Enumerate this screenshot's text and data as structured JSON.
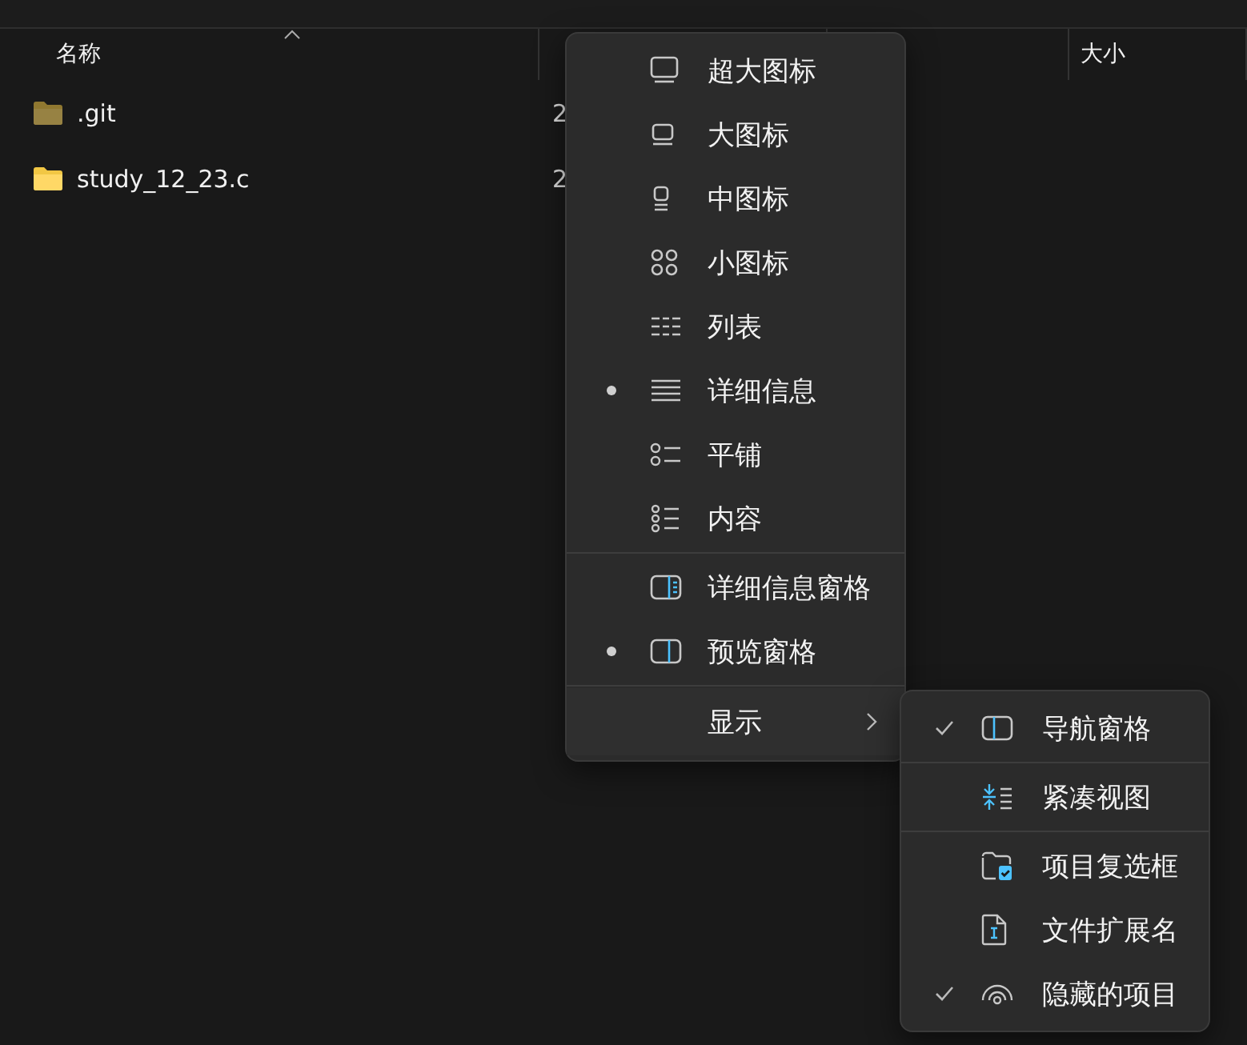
{
  "columns": [
    {
      "label": "名称",
      "sort_ascending": true
    },
    {
      "label": "大小"
    }
  ],
  "files": [
    {
      "name": ".git",
      "date": "2",
      "hidden": true
    },
    {
      "name": "study_12_23.c",
      "date": "2",
      "hidden": false
    }
  ],
  "view_menu": {
    "layouts": [
      {
        "label": "超大图标",
        "selected": false
      },
      {
        "label": "大图标",
        "selected": false
      },
      {
        "label": "中图标",
        "selected": false
      },
      {
        "label": "小图标",
        "selected": false
      },
      {
        "label": "列表",
        "selected": false
      },
      {
        "label": "详细信息",
        "selected": true
      },
      {
        "label": "平铺",
        "selected": false
      },
      {
        "label": "内容",
        "selected": false
      }
    ],
    "panes": [
      {
        "label": "详细信息窗格",
        "selected": false
      },
      {
        "label": "预览窗格",
        "selected": true
      }
    ],
    "show": {
      "label": "显示",
      "expanded": true
    }
  },
  "show_menu": [
    {
      "label": "导航窗格",
      "checked": true
    },
    {
      "label": "紧凑视图",
      "checked": false
    },
    {
      "label": "项目复选框",
      "checked": false
    },
    {
      "label": "文件扩展名",
      "checked": false
    },
    {
      "label": "隐藏的项目",
      "checked": true
    }
  ]
}
